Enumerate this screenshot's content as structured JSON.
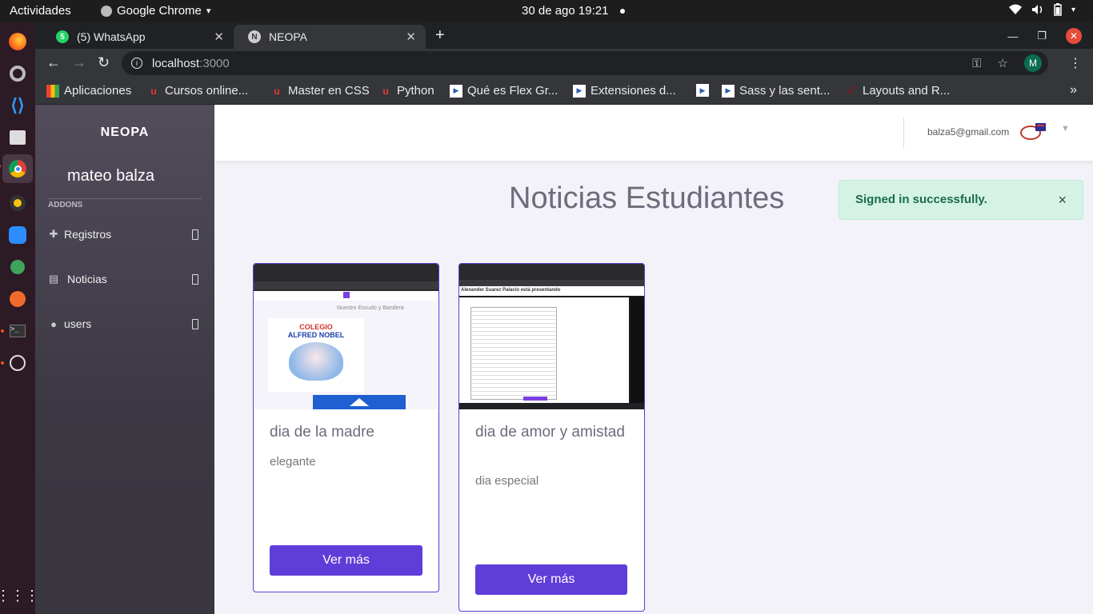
{
  "os": {
    "activities": "Actividades",
    "app_name": "Google Chrome",
    "app_caret": "▾",
    "clock": "30 de ago  19:21"
  },
  "browser": {
    "tabs": [
      {
        "label": "(5) WhatsApp",
        "badge": "5"
      },
      {
        "label": "NEOPA",
        "icon_letter": "N"
      }
    ],
    "url_host": "localhost",
    "url_port": ":3000",
    "profile_initial": "M",
    "bookmarks": [
      "Aplicaciones",
      "Cursos online...",
      "Master en CSS",
      "Python",
      "Qué es Flex Gr...",
      "Extensiones d...",
      "",
      "Sass y las sent...",
      "Layouts and R..."
    ],
    "bookmarks_more": "»"
  },
  "sidebar": {
    "brand": "NEOPA",
    "user": "mateo balza",
    "section": "ADDONS",
    "items": [
      {
        "label": "Registros",
        "icon": "plus-icon"
      },
      {
        "label": "Noticias",
        "icon": "newspaper-icon"
      },
      {
        "label": "users",
        "icon": "user-icon"
      }
    ]
  },
  "header": {
    "email": "balza5@gmail.com"
  },
  "page": {
    "title": "Noticias Estudiantes"
  },
  "alert": {
    "message": "Signed in successfully.",
    "close": "×"
  },
  "cards": [
    {
      "title": "dia de la madre",
      "description": "elegante",
      "button": "Ver más",
      "thumb_school": "COLEGIO",
      "thumb_name": "ALFRED NOBEL",
      "thumb_caption": "Nuestro Escudo y Bandera"
    },
    {
      "title": "dia de amor y amistad",
      "description": "dia especial",
      "button": "Ver más",
      "thumb_caption": "Alexander Suarez Palacio está presentando"
    }
  ],
  "colors": {
    "accent": "#5f3dd8",
    "alert_bg": "#d4f3e6",
    "alert_text": "#1a6b48",
    "sidebar_top": "#524c5b"
  }
}
